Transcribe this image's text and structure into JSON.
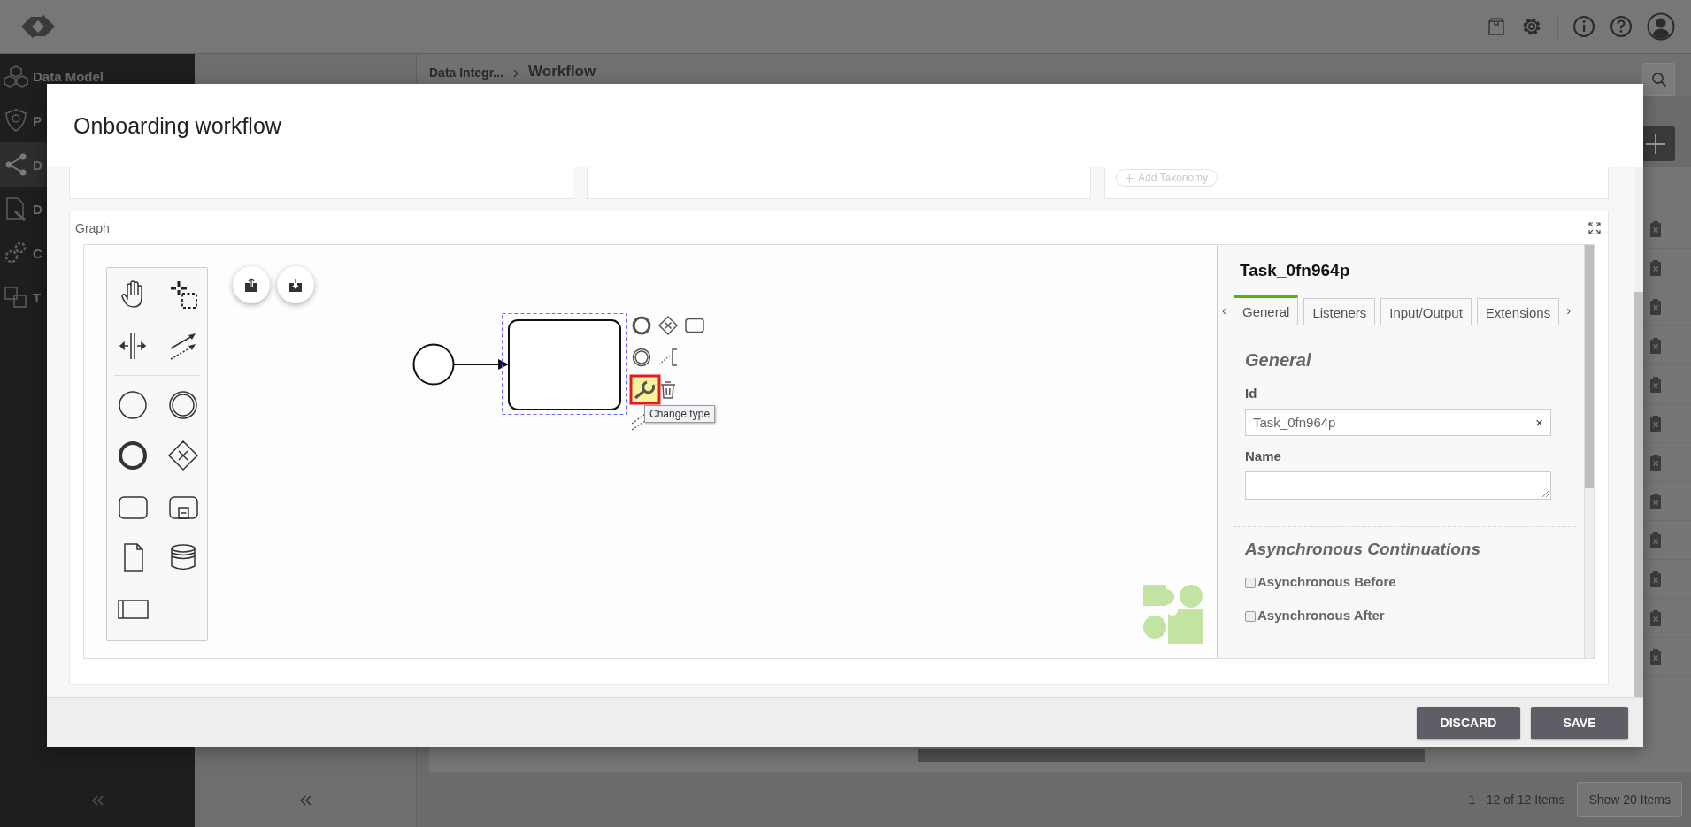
{
  "sidebar": {
    "items": [
      {
        "label": "Data Model",
        "selected": false
      },
      {
        "label": "P",
        "selected": false
      },
      {
        "label": "D",
        "selected": true
      },
      {
        "label": "D",
        "selected": false
      },
      {
        "label": "C",
        "selected": false
      },
      {
        "label": "T",
        "selected": false
      }
    ]
  },
  "breadcrumb": [
    "Data Integr...",
    "Workflow"
  ],
  "pagination": {
    "summary": "1 - 12 of 12 Items",
    "page_size_button": "Show 20 Items"
  },
  "modal": {
    "title": "Onboarding workflow",
    "taxonomy_button": "Add Taxonomy",
    "graph": {
      "label": "Graph",
      "diagram": {
        "task": {
          "selected": true
        },
        "tooltip": "Change type",
        "context_pad": [
          {
            "highlighted": false
          },
          {
            "highlighted": false
          },
          {
            "highlighted": false
          },
          {
            "highlighted": false
          },
          {
            "highlighted": false
          },
          {
            "highlighted": true
          },
          {
            "highlighted": false
          },
          {
            "highlighted": false
          }
        ]
      },
      "properties": {
        "title": "Task_0fn964p",
        "tab_prev": "‹",
        "tab_next": "›",
        "tabs": [
          {
            "label": "General",
            "selected": true
          },
          {
            "label": "Listeners",
            "selected": false
          },
          {
            "label": "Input/Output",
            "selected": false
          },
          {
            "label": "Extensions",
            "selected": false
          }
        ],
        "section": "General",
        "fields": [
          {
            "label": "Id",
            "kind": "input",
            "value": "Task_0fn964p",
            "clear": "×"
          },
          {
            "label": "Name",
            "kind": "textarea"
          }
        ],
        "subsection": "Asynchronous Continuations",
        "checkboxes": [
          {
            "label": "Asynchronous Before",
            "checked": false
          },
          {
            "label": "Asynchronous After",
            "checked": false
          }
        ]
      }
    },
    "buttons": [
      "DISCARD",
      "SAVE"
    ]
  }
}
